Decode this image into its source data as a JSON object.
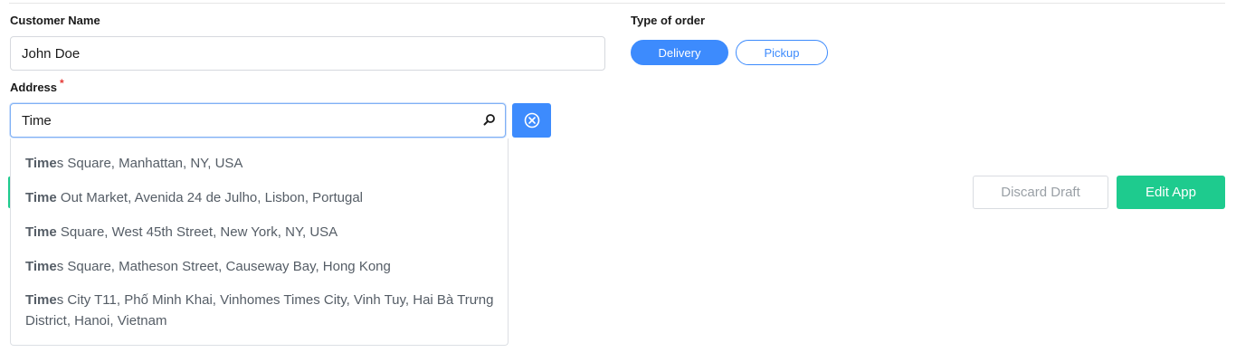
{
  "customer": {
    "label": "Customer Name",
    "value": "John Doe"
  },
  "order_type": {
    "label": "Type of order",
    "options": [
      "Delivery",
      "Pickup"
    ],
    "selected": "Delivery"
  },
  "address": {
    "label": "Address",
    "required_marker": "*",
    "value": "Time",
    "suggestions": [
      {
        "match": "Time",
        "rest": "s Square, Manhattan, NY, USA"
      },
      {
        "match": "Time",
        "rest": " Out Market, Avenida 24 de Julho, Lisbon, Portugal"
      },
      {
        "match": "Time",
        "rest": " Square, West 45th Street, New York, NY, USA"
      },
      {
        "match": "Time",
        "rest": "s Square, Matheson Street, Causeway Bay, Hong Kong"
      },
      {
        "match": "Time",
        "rest": "s City T11, Phố Minh Khai, Vinhomes Times City, Vinh Tuy, Hai Bà Trưng District, Hanoi, Vietnam"
      }
    ]
  },
  "actions": {
    "discard_label": "Discard Draft",
    "edit_label": "Edit App"
  },
  "colors": {
    "primary": "#3d8bfd",
    "success": "#1ecb8e",
    "required": "#e53935"
  },
  "icons": {
    "search": "search-icon",
    "clear": "clear-circle-x-icon"
  }
}
